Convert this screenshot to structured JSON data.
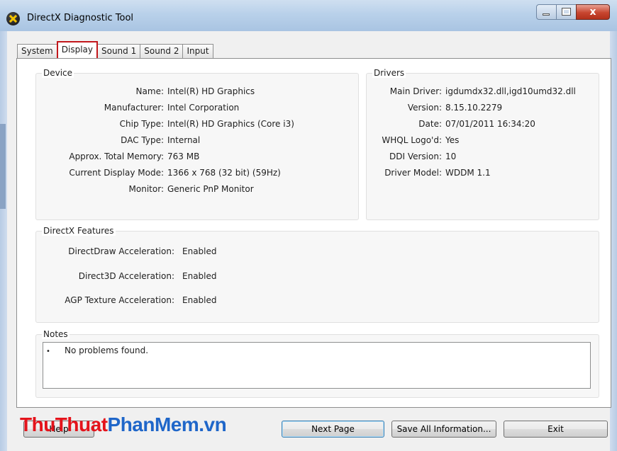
{
  "window": {
    "title": "DirectX Diagnostic Tool",
    "close_glyph": "x"
  },
  "tabs": [
    {
      "label": "System"
    },
    {
      "label": "Display"
    },
    {
      "label": "Sound 1"
    },
    {
      "label": "Sound 2"
    },
    {
      "label": "Input"
    }
  ],
  "device": {
    "title": "Device",
    "rows": [
      {
        "label": "Name:",
        "value": "Intel(R) HD Graphics"
      },
      {
        "label": "Manufacturer:",
        "value": "Intel Corporation"
      },
      {
        "label": "Chip Type:",
        "value": "Intel(R) HD Graphics (Core i3)"
      },
      {
        "label": "DAC Type:",
        "value": "Internal"
      },
      {
        "label": "Approx. Total Memory:",
        "value": "763 MB"
      },
      {
        "label": "Current Display Mode:",
        "value": "1366 x 768 (32 bit) (59Hz)"
      },
      {
        "label": "Monitor:",
        "value": "Generic PnP Monitor"
      }
    ]
  },
  "drivers": {
    "title": "Drivers",
    "rows": [
      {
        "label": "Main Driver:",
        "value": "igdumdx32.dll,igd10umd32.dll"
      },
      {
        "label": "Version:",
        "value": "8.15.10.2279"
      },
      {
        "label": "Date:",
        "value": "07/01/2011 16:34:20"
      },
      {
        "label": "WHQL Logo'd:",
        "value": "Yes"
      },
      {
        "label": "DDI Version:",
        "value": "10"
      },
      {
        "label": "Driver Model:",
        "value": "WDDM 1.1"
      }
    ]
  },
  "features": {
    "title": "DirectX Features",
    "rows": [
      {
        "label": "DirectDraw Acceleration:",
        "value": "Enabled"
      },
      {
        "label": "Direct3D Acceleration:",
        "value": "Enabled"
      },
      {
        "label": "AGP Texture Acceleration:",
        "value": "Enabled"
      }
    ]
  },
  "notes": {
    "title": "Notes",
    "bullet": "•",
    "text": "No problems found."
  },
  "buttons": {
    "help": "Help",
    "next": "Next Page",
    "save": "Save All Information...",
    "exit": "Exit"
  },
  "watermark": {
    "part1": "ThuThuat",
    "part2": "PhanMem",
    "part3": ".vn"
  }
}
